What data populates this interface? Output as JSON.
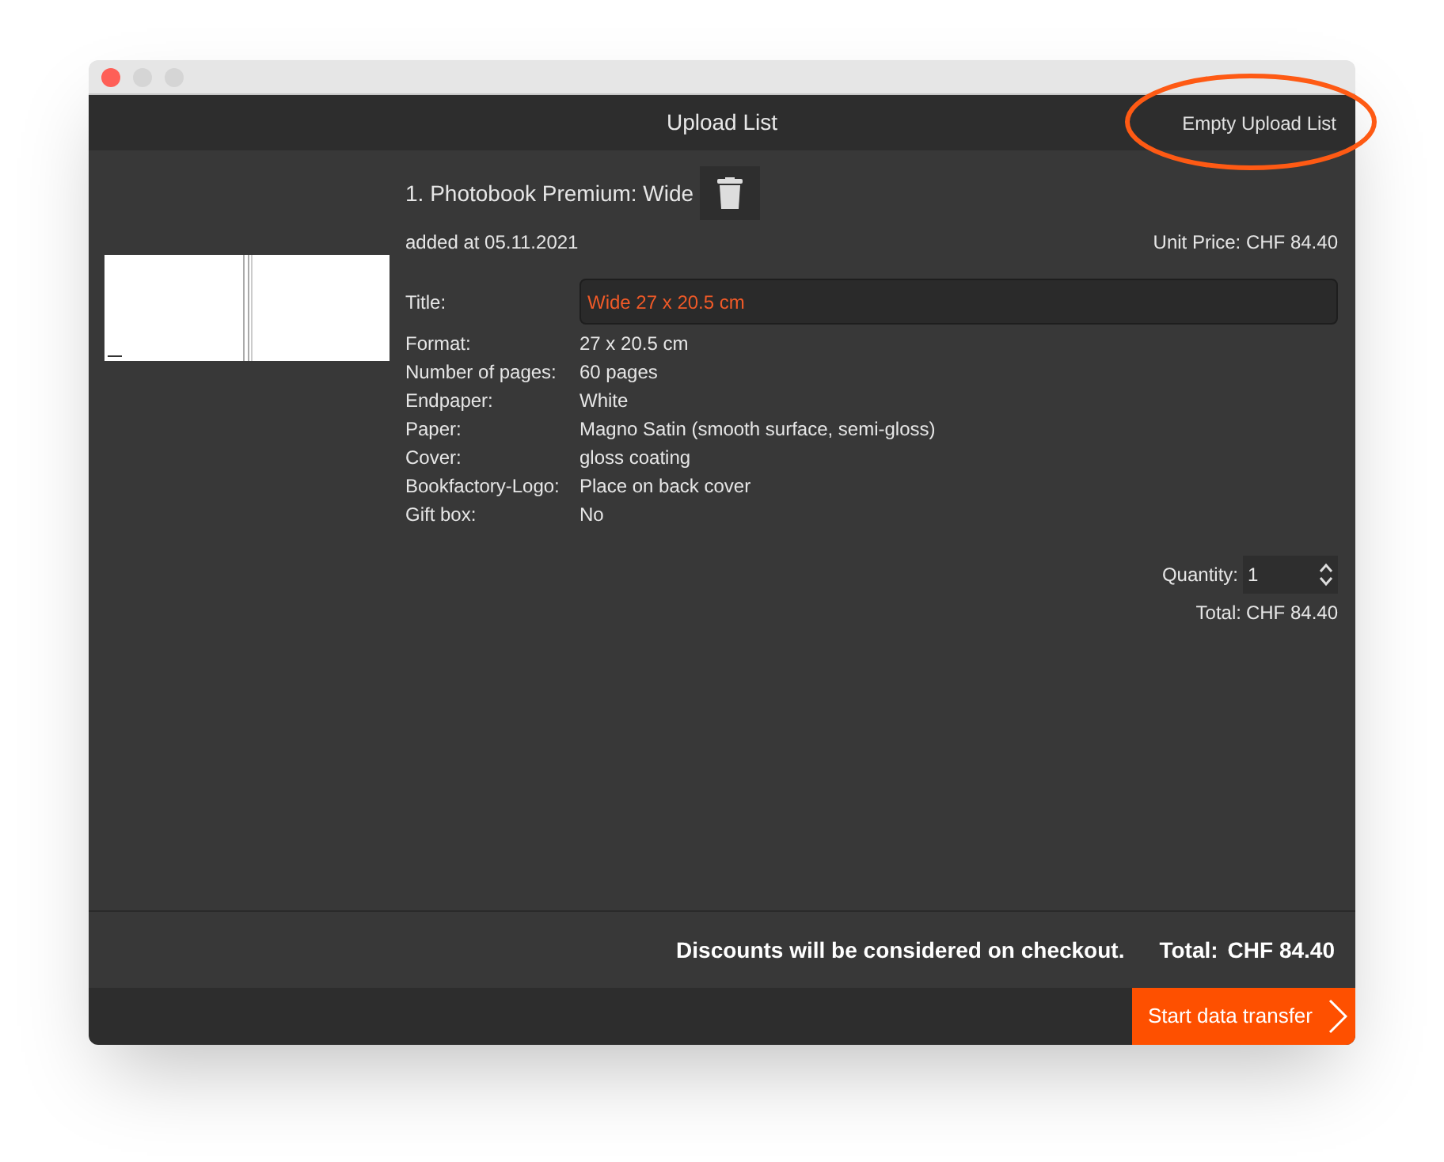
{
  "window": {
    "title": "Upload List"
  },
  "header_action": {
    "label": "Empty Upload List",
    "highlighted": true
  },
  "item": {
    "name": "1. Photobook Premium: Wide",
    "added": "added at 05.11.2021",
    "unit_price": "Unit Price: CHF 84.40",
    "title_label": "Title:",
    "title_value": "Wide 27 x 20.5 cm",
    "specs": [
      {
        "label": "Format:",
        "value": "27 x 20.5 cm"
      },
      {
        "label": "Number of pages:",
        "value": "60 pages"
      },
      {
        "label": "Endpaper:",
        "value": "White"
      },
      {
        "label": "Paper:",
        "value": "Magno Satin (smooth surface, semi-gloss)"
      },
      {
        "label": "Cover:",
        "value": "gloss coating"
      },
      {
        "label": "Bookfactory-Logo:",
        "value": "Place on back cover"
      },
      {
        "label": "Gift box:",
        "value": "No"
      }
    ],
    "quantity_label": "Quantity:",
    "quantity": "1",
    "total_label": "Total:",
    "total": "CHF 84.40"
  },
  "summary": {
    "note": "Discounts will be considered on checkout.",
    "total_label": "Total:",
    "total": "CHF 84.40"
  },
  "start_button": {
    "label": "Start data transfer"
  }
}
